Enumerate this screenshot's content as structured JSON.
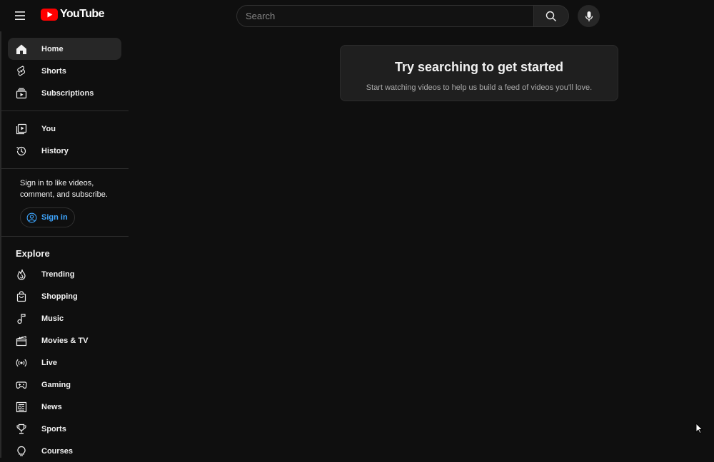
{
  "header": {
    "logo_text": "YouTube",
    "search_placeholder": "Search"
  },
  "sidebar": {
    "main": [
      {
        "label": "Home",
        "icon": "home-icon",
        "active": true
      },
      {
        "label": "Shorts",
        "icon": "shorts-icon"
      },
      {
        "label": "Subscriptions",
        "icon": "subscriptions-icon"
      }
    ],
    "you": [
      {
        "label": "You",
        "icon": "you-icon"
      },
      {
        "label": "History",
        "icon": "history-icon"
      }
    ],
    "signin_prompt": "Sign in to like videos, comment, and subscribe.",
    "signin_label": "Sign in",
    "explore_title": "Explore",
    "explore": [
      {
        "label": "Trending",
        "icon": "trending-icon"
      },
      {
        "label": "Shopping",
        "icon": "shopping-icon"
      },
      {
        "label": "Music",
        "icon": "music-icon"
      },
      {
        "label": "Movies & TV",
        "icon": "movies-icon"
      },
      {
        "label": "Live",
        "icon": "live-icon"
      },
      {
        "label": "Gaming",
        "icon": "gaming-icon"
      },
      {
        "label": "News",
        "icon": "news-icon"
      },
      {
        "label": "Sports",
        "icon": "sports-icon"
      },
      {
        "label": "Courses",
        "icon": "courses-icon"
      }
    ]
  },
  "main": {
    "empty_title": "Try searching to get started",
    "empty_subtitle": "Start watching videos to help us build a feed of videos you'll love."
  },
  "colors": {
    "background": "#0f0f0f",
    "brand_red": "#ff0000",
    "link_blue": "#3ea6ff",
    "active_bg": "#272727"
  }
}
